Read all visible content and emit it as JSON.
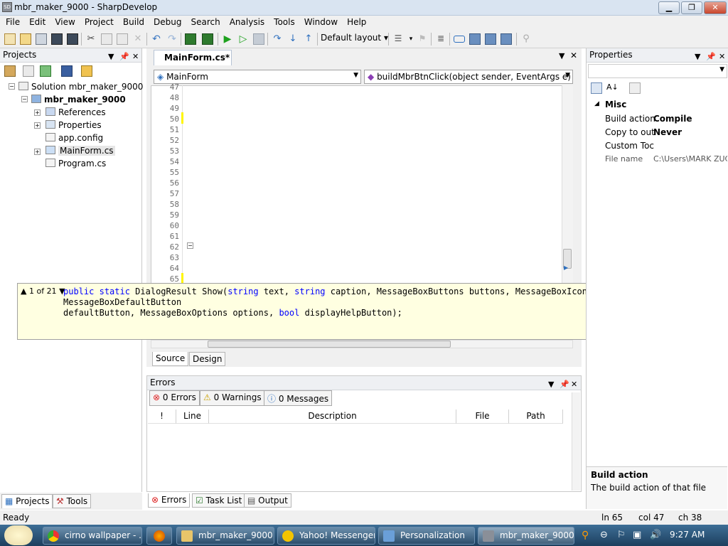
{
  "window": {
    "title": "mbr_maker_9000 - SharpDevelop",
    "icon_text": "SD",
    "min": "▁",
    "max": "❐",
    "close": "✕"
  },
  "menu": [
    "File",
    "Edit",
    "View",
    "Project",
    "Build",
    "Debug",
    "Search",
    "Analysis",
    "Tools",
    "Window",
    "Help"
  ],
  "toolbar": {
    "layout_label": "Default layout",
    "layout_arrow": "▾"
  },
  "projects": {
    "title": "Projects",
    "tree": {
      "solution": "Solution mbr_maker_9000",
      "project": "mbr_maker_9000",
      "references": "References",
      "properties": "Properties",
      "app_config": "app.config",
      "mainform": "MainForm.cs",
      "program": "Program.cs"
    },
    "tabs": {
      "projects": "Projects",
      "tools": "Tools"
    }
  },
  "editor": {
    "tab_label": "MainForm.cs*",
    "class_combo": "MainForm",
    "member_combo": "buildMbrBtnClick(object sender, EventArgs e)",
    "line_numbers": [
      "47",
      "48",
      "49",
      "50",
      "51",
      "52",
      "53",
      "54",
      "55",
      "56",
      "57",
      "58",
      "59",
      "60",
      "61",
      "62",
      "63",
      "64",
      "65"
    ],
    "source_tab": "Source",
    "design_tab": "Design"
  },
  "tooltip": {
    "counter": "1 of 21",
    "sig_public": "public",
    "sig_static": "static",
    "sig_rest1": " DialogResult Show(",
    "sig_string1": "string",
    "sig_text": " text, ",
    "sig_string2": "string",
    "sig_caption": " caption, MessageBoxButtons buttons, MessageBoxIcon icon, MessageBoxDefaultButton",
    "sig_line2": "defaultButton, MessageBoxOptions options, ",
    "sig_bool": "bool",
    "sig_end": " displayHelpButton);"
  },
  "errors": {
    "title": "Errors",
    "errors_btn": "0 Errors",
    "warnings_btn": "0 Warnings",
    "messages_btn": "0 Messages",
    "columns": [
      "!",
      "Line",
      "Description",
      "File",
      "Path"
    ],
    "bottom_tabs": {
      "errors": "Errors",
      "tasklist": "Task List",
      "output": "Output"
    }
  },
  "properties": {
    "title": "Properties",
    "category": "Misc",
    "rows": [
      {
        "name": "Build action",
        "value": "Compile"
      },
      {
        "name": "Copy to out",
        "value": "Never"
      },
      {
        "name": "Custom Toc",
        "value": ""
      },
      {
        "name": "File name",
        "value": "C:\\Users\\MARK ZUC"
      }
    ],
    "desc_title": "Build action",
    "desc_text": "The build action of that file"
  },
  "status": {
    "ready": "Ready",
    "line": "ln 65",
    "col": "col 47",
    "ch": "ch 38"
  },
  "taskbar": {
    "items": [
      "cirno wallpaper - ...",
      "mbr_maker_9000",
      "Yahoo! Messenger",
      "Personalization",
      "mbr_maker_9000 ..."
    ],
    "clock": "9:27 AM"
  },
  "colors": {
    "keyword": "#0000ff",
    "string": "#0000b0",
    "comment": "#008000",
    "tooltip_bg": "#ffffe1",
    "taskbar": "#2a5478"
  }
}
